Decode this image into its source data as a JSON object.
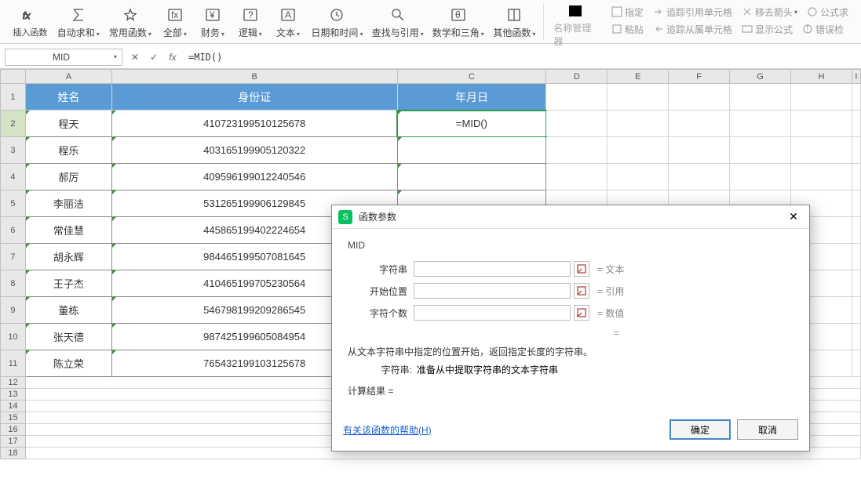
{
  "ribbon": {
    "insert_fn": "插入函数",
    "autosum": "自动求和",
    "common": "常用函数",
    "all": "全部",
    "finance": "财务",
    "logic": "逻辑",
    "text": "文本",
    "datetime": "日期和时间",
    "lookup": "查找与引用",
    "math": "数学和三角",
    "other": "其他函数",
    "name_mgr": "名称管理器",
    "paste": "粘贴",
    "define": "指定",
    "trace_ref": "追踪引用单元格",
    "remove_arrow": "移去箭头",
    "formula_eval": "公式求",
    "trace_dep": "追踪从属单元格",
    "show_fml": "显示公式",
    "error_chk": "错误检"
  },
  "formula_bar": {
    "name_box": "MID",
    "formula": "=MID()"
  },
  "columns": [
    "A",
    "B",
    "C",
    "D",
    "E",
    "F",
    "G",
    "H",
    "I"
  ],
  "header_row": {
    "a": "姓名",
    "b": "身份证",
    "c": "年月日"
  },
  "rows": [
    {
      "a": "程天",
      "b": "410723199510125678",
      "c": "=MID()"
    },
    {
      "a": "程乐",
      "b": "403165199905120322",
      "c": ""
    },
    {
      "a": "郝厉",
      "b": "409596199012240546",
      "c": ""
    },
    {
      "a": "李丽洁",
      "b": "531265199906129845",
      "c": ""
    },
    {
      "a": "常佳慧",
      "b": "445865199402224654",
      "c": ""
    },
    {
      "a": "胡永辉",
      "b": "984465199507081645",
      "c": ""
    },
    {
      "a": "王子杰",
      "b": "410465199705230564",
      "c": ""
    },
    {
      "a": "董栋",
      "b": "546798199209286545",
      "c": ""
    },
    {
      "a": "张天德",
      "b": "987425199605084954",
      "c": ""
    },
    {
      "a": "陈立荣",
      "b": "765432199103125678",
      "c": ""
    }
  ],
  "dialog": {
    "title": "函数参数",
    "fn_name": "MID",
    "args": [
      {
        "label": "字符串",
        "hint": "文本"
      },
      {
        "label": "开始位置",
        "hint": "引用"
      },
      {
        "label": "字符个数",
        "hint": "数值"
      }
    ],
    "eq": "=",
    "desc1": "从文本字符串中指定的位置开始，返回指定长度的字符串。",
    "desc2_label": "字符串:",
    "desc2_text": "准备从中提取字符串的文本字符串",
    "result_label": "计算结果 =",
    "help": "有关该函数的帮助(H)",
    "ok": "确定",
    "cancel": "取消"
  }
}
